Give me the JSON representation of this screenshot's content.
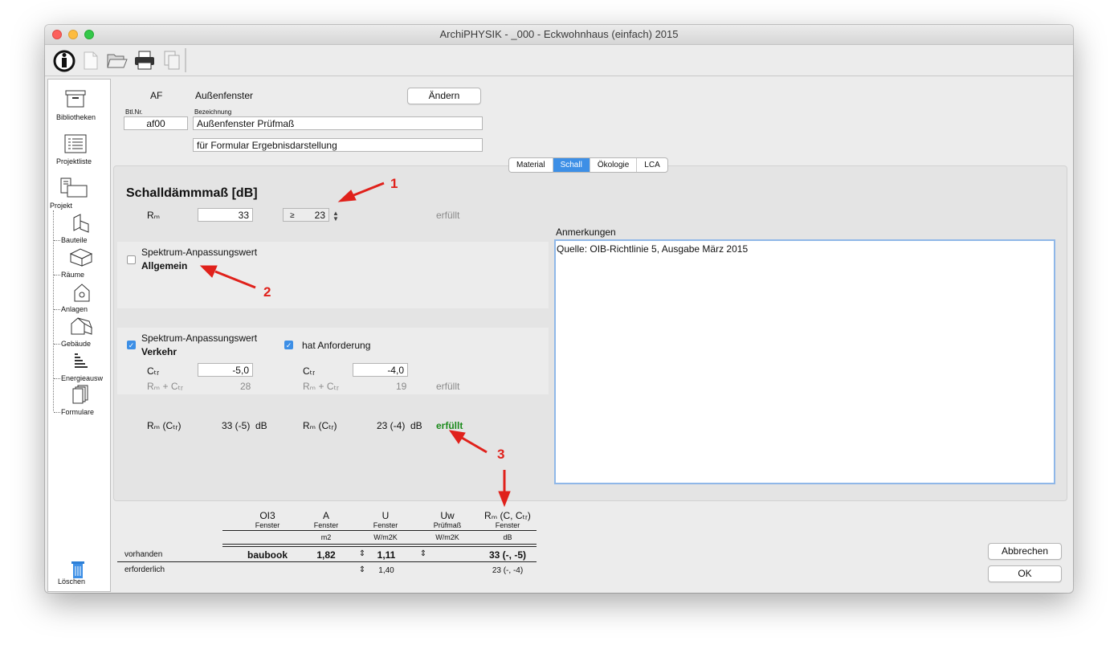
{
  "window": {
    "title": "ArchiPHYSIK - _000 - Eckwohnhaus (einfach) 2015"
  },
  "toolbar": {
    "icons": [
      "info-icon",
      "new-document-icon",
      "open-folder-icon",
      "print-icon",
      "copy-icon"
    ]
  },
  "sidebar": {
    "items": [
      "Bibliotheken",
      "Projektliste",
      "Projekt",
      "Bauteile",
      "Räume",
      "Anlagen",
      "Gebäude",
      "Energieausw",
      "Formulare"
    ],
    "delete_label": "Löschen"
  },
  "header": {
    "code": "AF",
    "name": "Außenfenster",
    "change_button": "Ändern",
    "btlnr_label": "Btl.Nr.",
    "btlnr_value": "af00",
    "bezeichnung_label": "Bezeichnung",
    "bezeichnung_value": "Außenfenster Prüfmaß",
    "subtitle_value": "für Formular Ergebnisdarstellung"
  },
  "tabs": [
    {
      "label": "Material",
      "active": false
    },
    {
      "label": "Schall",
      "active": true
    },
    {
      "label": "Ökologie",
      "active": false
    },
    {
      "label": "LCA",
      "active": false
    }
  ],
  "schall": {
    "title": "Schalldämmmaß [dB]",
    "rw_label": "Rₘ",
    "rw_value": "33",
    "req_operator": "≥",
    "req_value": "23",
    "status": "erfüllt",
    "spectrum_general": {
      "label": "Spektrum-Anpassungswert",
      "sub": "Allgemein",
      "checked": false
    },
    "spectrum_traffic": {
      "label": "Spektrum-Anpassungswert",
      "sub": "Verkehr",
      "checked": true
    },
    "has_requirement": {
      "label": "hat Anforderung",
      "checked": true
    },
    "ctr_label": "Cₜᵣ",
    "ctr_value": "-5,0",
    "ctr_req_value": "-4,0",
    "sum_label": "Rₘ + Cₜᵣ",
    "sum_value": "28",
    "sum_req_value": "19",
    "sum_status": "erfüllt",
    "result_label": "Rₘ (Cₜᵣ)",
    "result_value": "33 (-5)",
    "result_unit": "dB",
    "result_req_label": "Rₘ (Cₜᵣ)",
    "result_req_value": "23 (-4)",
    "result_req_unit": "dB",
    "result_status": "erfüllt"
  },
  "remarks": {
    "label": "Anmerkungen",
    "text": "Quelle: OIB-Richtlinie 5, Ausgabe März 2015"
  },
  "annotations": [
    "1",
    "2",
    "3"
  ],
  "table": {
    "columns": [
      {
        "title": "OI3",
        "sub": "Fenster",
        "unit": ""
      },
      {
        "title": "A",
        "sub": "Fenster",
        "unit": "m2"
      },
      {
        "title": "U",
        "sub": "Fenster",
        "unit": "W/m2K"
      },
      {
        "title": "Uw",
        "sub": "Prüfmaß",
        "unit": "W/m2K"
      },
      {
        "title": "Rₘ (C, Cₜᵣ)",
        "sub": "Fenster",
        "unit": "dB"
      }
    ],
    "rows": [
      {
        "label": "vorhanden",
        "values": [
          "baubook",
          "1,82",
          "1,11",
          "",
          "33 (-, -5)"
        ]
      },
      {
        "label": "erforderlich",
        "values": [
          "",
          "",
          "1,40",
          "",
          "23 (-, -4)"
        ]
      }
    ],
    "stepper_glyph": "⇕"
  },
  "buttons": {
    "cancel": "Abbrechen",
    "ok": "OK"
  }
}
